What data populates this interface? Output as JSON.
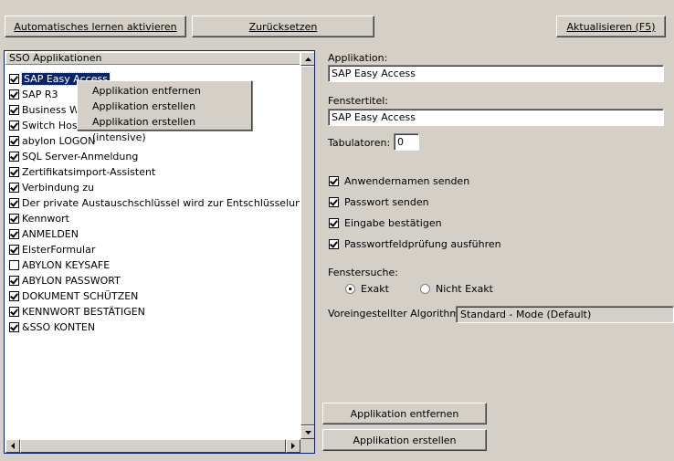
{
  "toolbar": {
    "auto_learn_label": "Automatisches lernen aktivieren",
    "reset_label": "Zurücksetzen",
    "refresh_label": "Aktualisieren (F5)"
  },
  "list": {
    "header": "SSO Applikationen",
    "items": [
      {
        "label": "SAP Easy Access",
        "checked": true
      },
      {
        "label": "SAP R3",
        "checked": true
      },
      {
        "label": "Business W",
        "checked": true
      },
      {
        "label": "Switch Hosl",
        "checked": true
      },
      {
        "label": "abylon LOGON",
        "checked": true
      },
      {
        "label": "SQL Server-Anmeldung",
        "checked": true
      },
      {
        "label": "Zertifikatsimport-Assistent",
        "checked": true
      },
      {
        "label": "Verbindung zu",
        "checked": true
      },
      {
        "label": "Der private Austauschschlüssel wird zur Entschlüsselung verw...",
        "checked": true
      },
      {
        "label": "Kennwort",
        "checked": true
      },
      {
        "label": "ANMELDEN",
        "checked": true
      },
      {
        "label": "ElsterFormular",
        "checked": true
      },
      {
        "label": "ABYLON KEYSAFE",
        "checked": false
      },
      {
        "label": "ABYLON PASSWORT",
        "checked": true
      },
      {
        "label": "DOKUMENT SCHÜTZEN",
        "checked": true
      },
      {
        "label": "KENNWORT BESTÄTIGEN",
        "checked": true
      },
      {
        "label": "&SSO KONTEN",
        "checked": true
      }
    ]
  },
  "context_menu": {
    "items": [
      "Applikation entfernen",
      "Applikation erstellen",
      "Applikation erstellen (intensive)"
    ]
  },
  "details": {
    "app_label": "Applikation:",
    "app_value": "SAP Easy Access",
    "title_label": "Fenstertitel:",
    "title_value": "SAP Easy Access",
    "tabs_label": "Tabulatoren:",
    "tabs_value": "0",
    "options": [
      {
        "label": "Anwendernamen senden",
        "checked": true
      },
      {
        "label": "Passwort senden",
        "checked": true
      },
      {
        "label": "Eingabe bestätigen",
        "checked": true
      },
      {
        "label": "Passwortfeldprüfung ausführen",
        "checked": true
      }
    ],
    "search_label": "Fenstersuche:",
    "search_exact": "Exakt",
    "search_not_exact": "Nicht Exakt",
    "search_selected": "Exakt",
    "algo_label": "Voreingestellter Algorithmus:",
    "algo_value": "Standard - Mode (Default)"
  },
  "actions": {
    "remove_label": "Applikation entfernen",
    "create_label": "Applikation erstellen"
  }
}
